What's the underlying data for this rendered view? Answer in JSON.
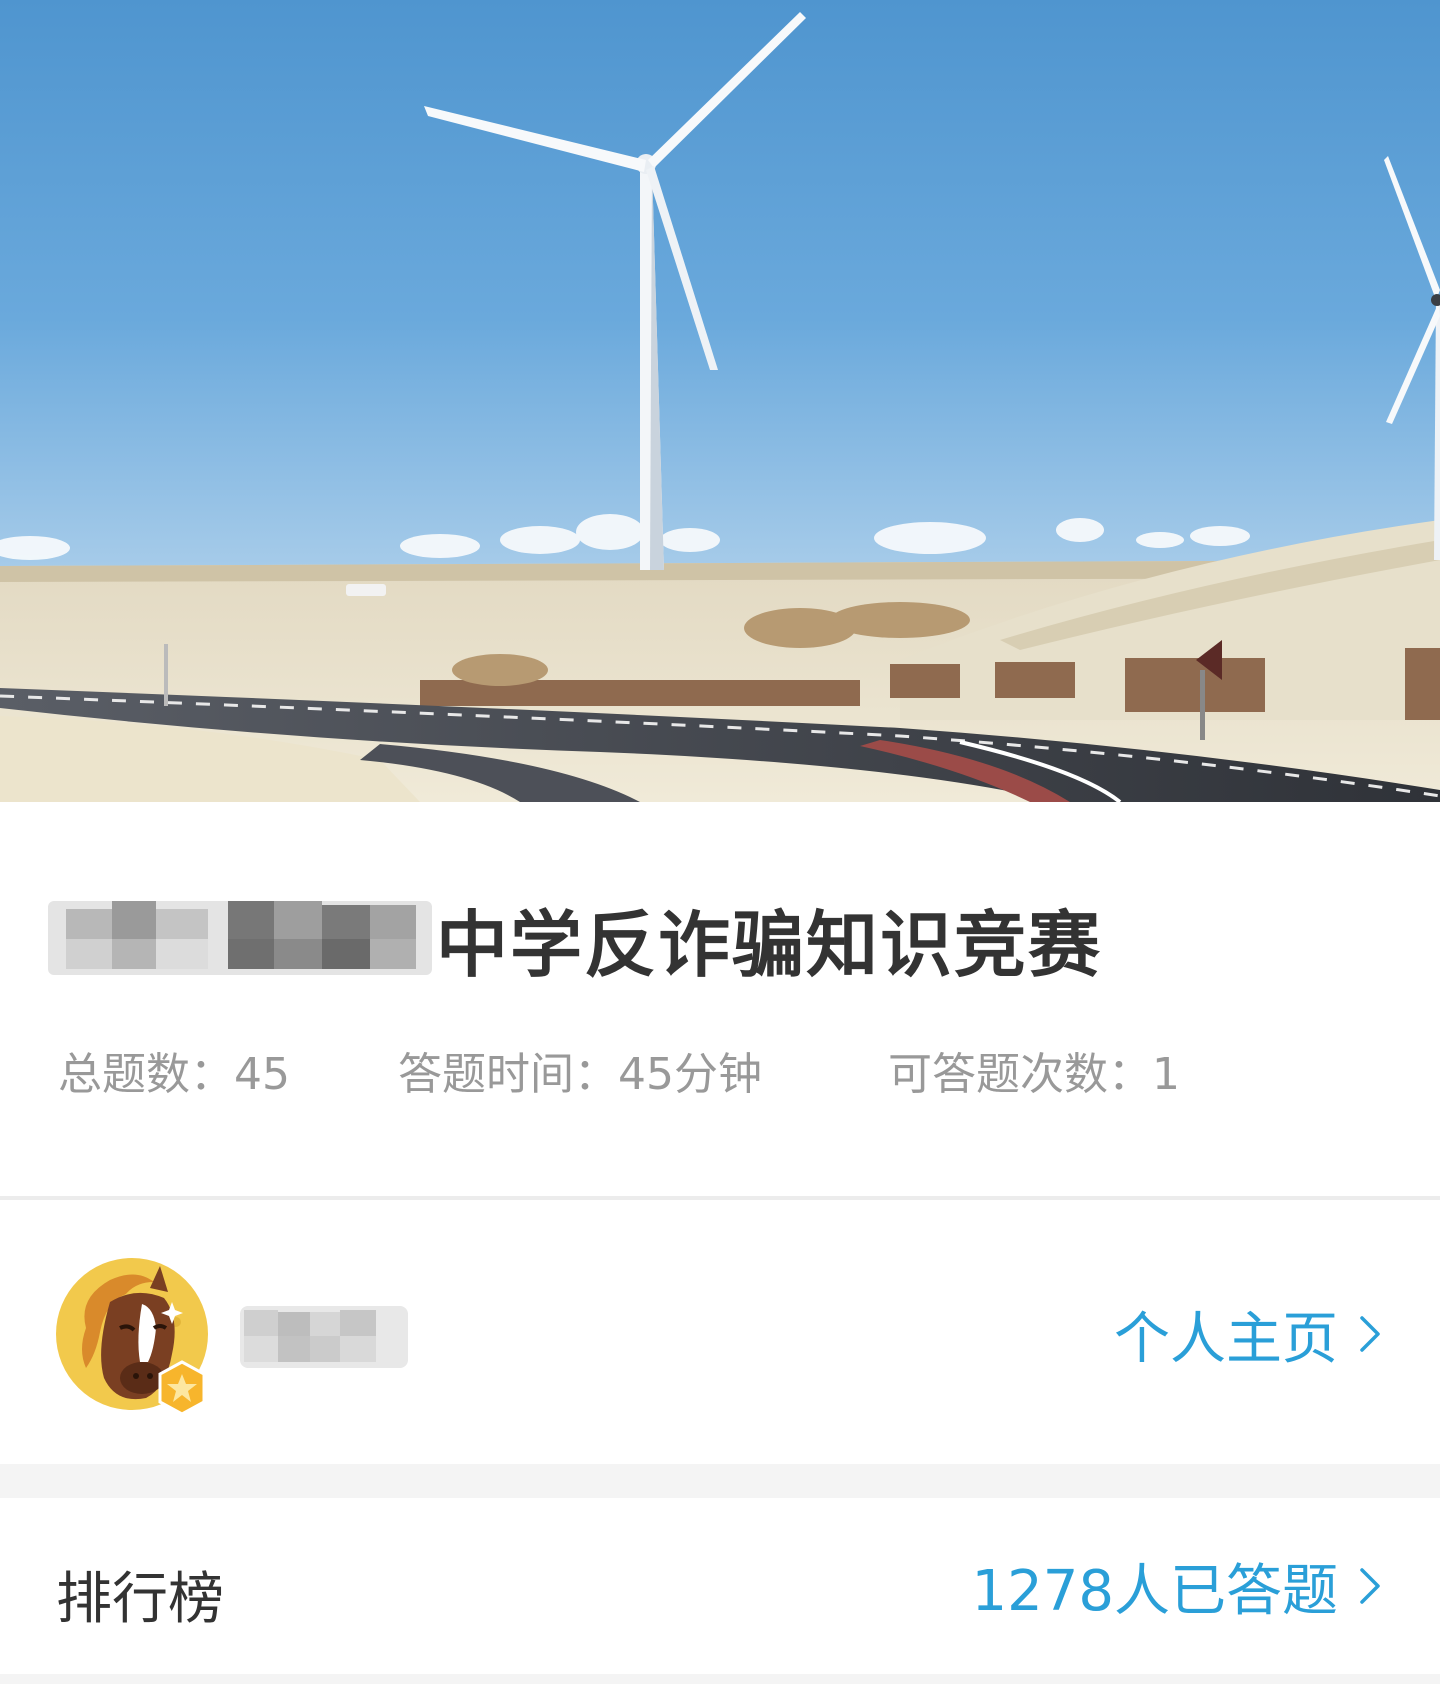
{
  "banner": {
    "image_description_icon": "wind-turbine-landscape-image"
  },
  "quiz": {
    "title": "中学反诈骗知识竞赛",
    "stats": {
      "total_questions_label": "总题数：",
      "total_questions_value": "45",
      "time_label": "答题时间：",
      "time_value": "45分钟",
      "attempts_label": "可答题次数：",
      "attempts_value": "1"
    }
  },
  "user": {
    "avatar_icon": "horse-avatar-icon",
    "badge_icon": "star-badge-icon",
    "profile_link_label": "个人主页"
  },
  "leaderboard": {
    "title": "排行榜",
    "count_text": "1278人已答题"
  },
  "colors": {
    "accent": "#2a9fd8",
    "title_text": "#333333",
    "muted_text": "#999999",
    "divider": "#ececec",
    "section_gap": "#f4f4f4"
  }
}
